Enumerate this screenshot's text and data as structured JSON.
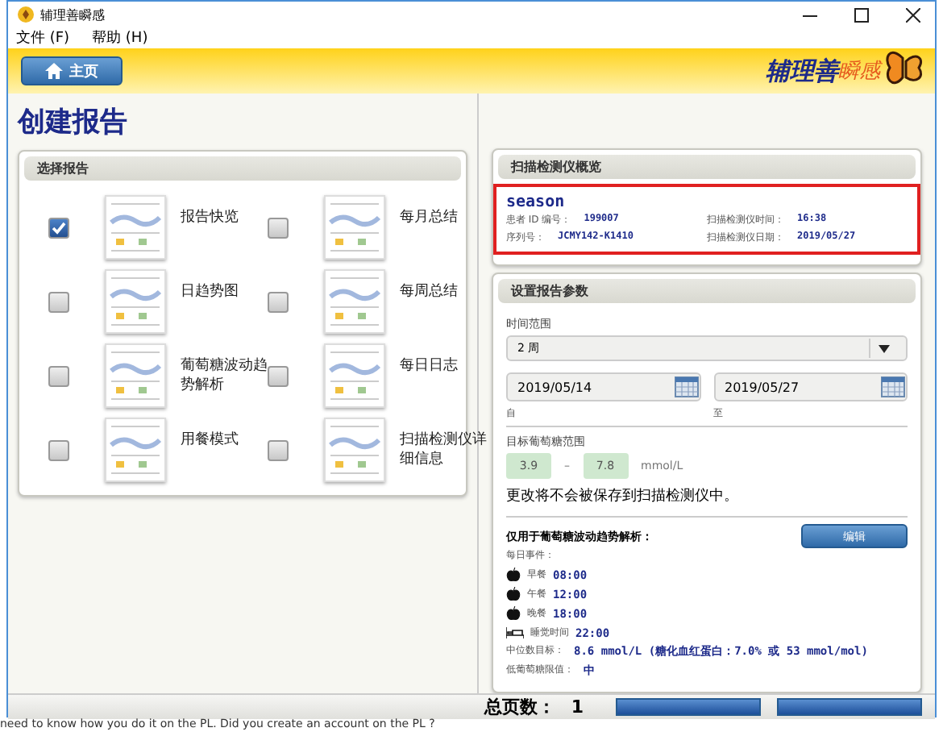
{
  "window": {
    "title": "辅理善瞬感"
  },
  "menu": [
    "文件 (F)",
    "帮助 (H)"
  ],
  "header": {
    "home_button": "主页",
    "brand": "辅理善",
    "brand_accent": "瞬感"
  },
  "page_title": "创建报告",
  "select_reports": {
    "title": "选择报告",
    "items": [
      {
        "label": "报告快览",
        "checked": true
      },
      {
        "label": "每月总结",
        "checked": false
      },
      {
        "label": "日趋势图",
        "checked": false
      },
      {
        "label": "每周总结",
        "checked": false
      },
      {
        "label": "葡萄糖波动趋势解析",
        "checked": false
      },
      {
        "label": "每日日志",
        "checked": false
      },
      {
        "label": "用餐模式",
        "checked": false
      },
      {
        "label": "扫描检测仪详细信息",
        "checked": false
      }
    ]
  },
  "overview": {
    "title": "扫描检测仪概览",
    "name": "season",
    "fields": [
      {
        "label": "患者 ID 编号：",
        "value": "199007"
      },
      {
        "label": "扫描检测仪时间：",
        "value": "16:38"
      },
      {
        "label": "序列号：",
        "value": "JCMY142-K1410"
      },
      {
        "label": "扫描检测仪日期：",
        "value": "2019/05/27"
      }
    ]
  },
  "params": {
    "title": "设置报告参数",
    "range_label": "时间范围",
    "range_value": "2 周",
    "from": {
      "value": "2019/05/14",
      "caption": "自"
    },
    "to": {
      "value": "2019/05/27",
      "caption": "至"
    },
    "target_label": "目标葡萄糖范围",
    "target_low": "3.9",
    "dash": "–",
    "target_high": "7.8",
    "unit": "mmol/L",
    "note": "更改将不会被保存到扫描检测仪中。",
    "agp_title": "仅用于葡萄糖波动趋势解析：",
    "edit_button": "编辑",
    "events_label": "每日事件：",
    "events": [
      {
        "kind": "meal",
        "label": "早餐",
        "time": "08:00"
      },
      {
        "kind": "meal",
        "label": "午餐",
        "time": "12:00"
      },
      {
        "kind": "meal",
        "label": "晚餐",
        "time": "18:00"
      },
      {
        "kind": "sleep",
        "label": "睡觉时间",
        "time": "22:00"
      }
    ],
    "median_label": "中位数目标：",
    "median_value": "8.6 mmol/L (糖化血红蛋白：7.0% 或 53 mmol/mol)",
    "low_label": "低葡萄糖限值：",
    "low_value": "中"
  },
  "footer": {
    "pages_label": "总页数：",
    "pages": "1"
  },
  "background_text": "need to know how you do it on the PL. Did you create an account on the PL ?"
}
